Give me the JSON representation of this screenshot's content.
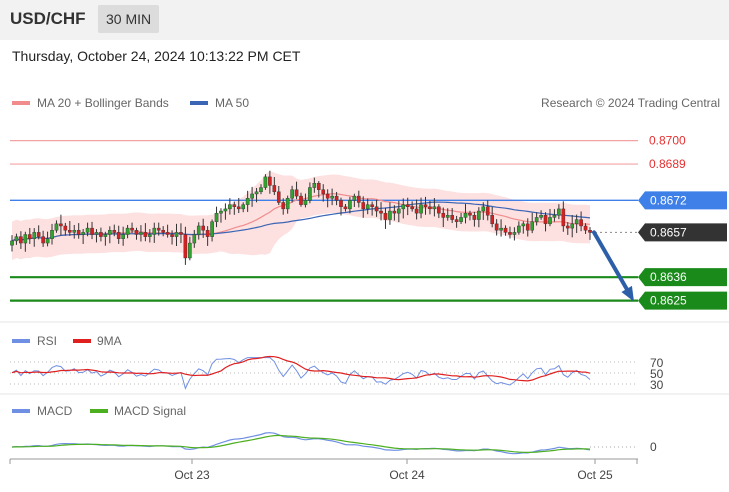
{
  "header": {
    "symbol": "USD/CHF",
    "timeframe": "30 MIN"
  },
  "datetime": "Thursday, October 24, 2024 10:13:22 PM CET",
  "legend": {
    "main": [
      {
        "label": "MA 20 + Bollinger Bands",
        "color": "#f08c8c"
      },
      {
        "label": "MA 50",
        "color": "#3b65b5"
      }
    ],
    "rsi": [
      {
        "label": "RSI",
        "color": "#6f8fe3"
      },
      {
        "label": "9MA",
        "color": "#e02020"
      }
    ],
    "macd": [
      {
        "label": "MACD",
        "color": "#6f8fe3"
      },
      {
        "label": "MACD Signal",
        "color": "#4caf20"
      }
    ]
  },
  "credit": "Research © 2024 Trading Central",
  "levels": [
    {
      "value": 0.87,
      "label": "0.8700",
      "kind": "resistance-line",
      "color": "#f4a3a3",
      "text_color": "#e53030"
    },
    {
      "value": 0.8689,
      "label": "0.8689",
      "kind": "resistance-line",
      "color": "#f4a3a3",
      "text_color": "#e53030"
    },
    {
      "value": 0.8672,
      "label": "0.8672",
      "kind": "pivot",
      "color": "#3f7fe8",
      "text_color": "#ffffff"
    },
    {
      "value": 0.8657,
      "label": "0.8657",
      "kind": "last",
      "color": "#333333",
      "text_color": "#ffffff"
    },
    {
      "value": 0.8636,
      "label": "0.8636",
      "kind": "support",
      "color": "#1a8a1a",
      "text_color": "#ffffff"
    },
    {
      "value": 0.8625,
      "label": "0.8625",
      "kind": "support",
      "color": "#1a8a1a",
      "text_color": "#ffffff"
    }
  ],
  "rsi_levels": [
    "70",
    "50",
    "30"
  ],
  "macd_zero": "0",
  "x_axis_labels": [
    "Oct 23",
    "Oct 24",
    "Oct 25"
  ],
  "colors": {
    "up": "#2fa22f",
    "down": "#d42020",
    "band_fill": "#fde0e0",
    "arrow": "#2d5fa8"
  },
  "chart_data": {
    "type": "candlestick",
    "instrument": "USD/CHF",
    "interval": "30 MIN",
    "price_range": [
      0.8615,
      0.8712
    ],
    "series": [
      {
        "name": "MA 20 + Bollinger Bands",
        "values": []
      },
      {
        "name": "MA 50",
        "values": []
      }
    ],
    "key_levels": [
      0.87,
      0.8689,
      0.8672,
      0.8657,
      0.8636,
      0.8625
    ],
    "last_price": 0.8657,
    "forecast": "down toward 0.8625",
    "closes": [
      0.8653,
      0.8655,
      0.8652,
      0.8656,
      0.8654,
      0.8657,
      0.8655,
      0.8652,
      0.8654,
      0.8658,
      0.8661,
      0.866,
      0.8658,
      0.8657,
      0.8658,
      0.8656,
      0.8657,
      0.8659,
      0.8656,
      0.8657,
      0.8655,
      0.8656,
      0.8658,
      0.8657,
      0.8654,
      0.8656,
      0.8659,
      0.8658,
      0.8656,
      0.8657,
      0.8655,
      0.8656,
      0.8659,
      0.8658,
      0.8657,
      0.8656,
      0.8655,
      0.8657,
      0.8656,
      0.8645,
      0.8652,
      0.8656,
      0.866,
      0.8658,
      0.8655,
      0.8662,
      0.8666,
      0.8667,
      0.8668,
      0.867,
      0.8669,
      0.8668,
      0.867,
      0.8673,
      0.8675,
      0.8676,
      0.8678,
      0.8683,
      0.8679,
      0.8676,
      0.8671,
      0.8668,
      0.8673,
      0.8677,
      0.8674,
      0.867,
      0.8672,
      0.8678,
      0.868,
      0.8677,
      0.8675,
      0.8673,
      0.8674,
      0.8672,
      0.8669,
      0.8668,
      0.8672,
      0.8674,
      0.8671,
      0.8668,
      0.867,
      0.8669,
      0.8667,
      0.8666,
      0.8663,
      0.8667,
      0.8666,
      0.8668,
      0.867,
      0.8669,
      0.8668,
      0.8666,
      0.867,
      0.8669,
      0.8668,
      0.8669,
      0.8666,
      0.8664,
      0.8665,
      0.8663,
      0.8662,
      0.8664,
      0.8666,
      0.8665,
      0.8663,
      0.8667,
      0.8669,
      0.8665,
      0.8661,
      0.8658,
      0.8659,
      0.8657,
      0.8656,
      0.8657,
      0.866,
      0.8661,
      0.8658,
      0.8662,
      0.8664,
      0.8665,
      0.8661,
      0.8664,
      0.8665,
      0.8668,
      0.866,
      0.8659,
      0.8661,
      0.8663,
      0.866,
      0.8658,
      0.8657
    ]
  },
  "rsi_data": {
    "rsi": [],
    "ma9": []
  },
  "macd_data": {
    "macd": [],
    "signal": []
  }
}
